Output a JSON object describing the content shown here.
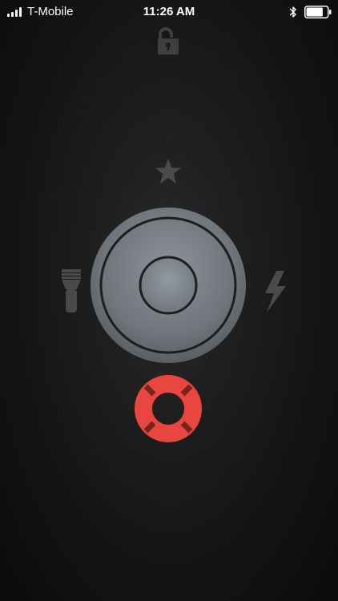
{
  "status_bar": {
    "carrier": "T-Mobile",
    "time": "11:26 AM",
    "signal_bars": 4,
    "battery_level": 0.8
  },
  "icons": {
    "lock": "unlocked-padlock",
    "favorites": "star",
    "flashlight": "flashlight",
    "strobe": "lightning-bolt",
    "power": "power-knob",
    "sos": "life-ring"
  },
  "colors": {
    "background": "#141414",
    "icon_gray": "#4a4a4a",
    "knob_gray": "#7a8085",
    "sos_red": "#e8463f"
  }
}
